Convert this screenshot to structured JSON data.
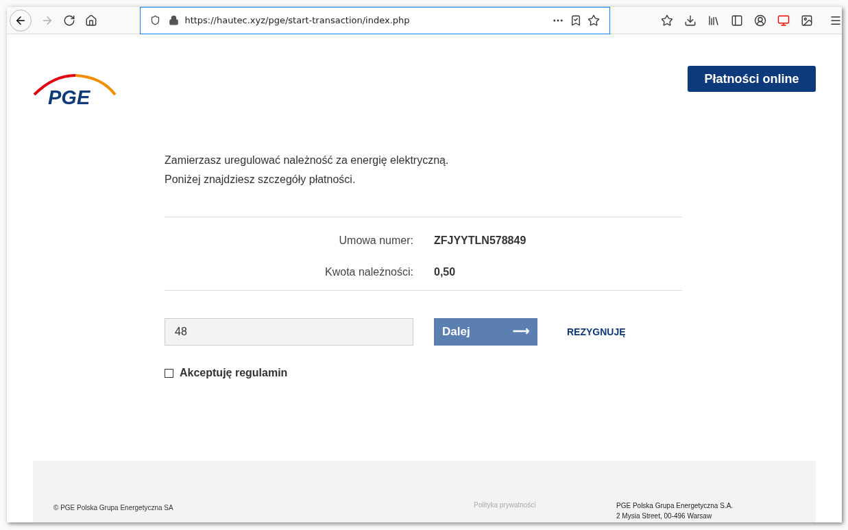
{
  "browser": {
    "url": "https://hautec.xyz/pge/start-transaction/index.php"
  },
  "header": {
    "logo": "PGE",
    "button": "Płatności online"
  },
  "intro": [
    "Zamierzasz uregulować należność za energię elektryczną.",
    "Poniżej znajdziesz szczegóły płatności."
  ],
  "details": [
    {
      "label": "Umowa numer:",
      "value": "ZFJYYTLN578849"
    },
    {
      "label": "Kwota należności:",
      "value": "0,50"
    }
  ],
  "form": {
    "code_value": "48",
    "next_button": "Dalej",
    "next_arrow": "⟶",
    "cancel_link": "REZYGNUJĘ",
    "terms": {
      "label": "Akceptuję regulamin",
      "checked": false
    }
  },
  "footer": {
    "copyright": "© PGE Polska Grupa Energetyczna SA",
    "privacy_link": "Polityka prywatności",
    "address": [
      "PGE Polska Grupa Energetyczna S.A.",
      "2 Mysia Street, 00-496 Warsaw"
    ]
  }
}
